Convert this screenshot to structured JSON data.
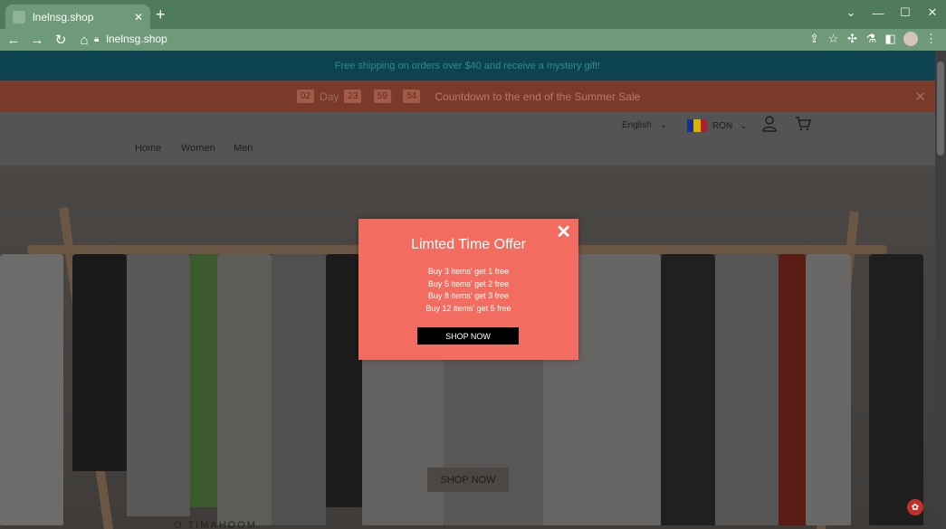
{
  "browser": {
    "tab_title": "lnelnsg.shop",
    "tab_close": "✕",
    "new_tab": "+",
    "url": "lnelnsg.shop",
    "win_controls": [
      "⌄",
      "—",
      "☐",
      "✕"
    ]
  },
  "banner": {
    "shipping_text": "Free shipping on orders over $40 and receive a mystery gift!"
  },
  "countdown": {
    "days": "02",
    "day_label": "Day",
    "hours": "23",
    "minutes": "59",
    "seconds": "54",
    "separator": ":",
    "message": "Countdown to the end of the Summer Sale",
    "close": "✕"
  },
  "header": {
    "nav": [
      "Home",
      "Women",
      "Men"
    ],
    "language": "English",
    "currency": "RON",
    "flag_colors": [
      "#1a2f8c",
      "#d6b400",
      "#b0202a"
    ]
  },
  "hero": {
    "shop_now": "SHOP NOW",
    "footer_text": "O TIMAHOOM"
  },
  "popup": {
    "title": "Limted Time Offer",
    "offers": [
      "Buy 3 items' get 1 free",
      "Buy 5 items' get 2 free",
      "Buy 8 items' get 3 free",
      "Buy 12 items' get 5 free"
    ],
    "cta": "SHOP NOW",
    "close": "✕"
  },
  "icons": [
    "back-icon",
    "forward-icon",
    "reload-icon",
    "home-icon",
    "lock-icon",
    "share-icon",
    "star-icon",
    "extensions-icon",
    "lab-icon",
    "sidepanel-icon",
    "profile-icon",
    "menu-icon",
    "user-icon",
    "cart-icon",
    "chevron-down-icon",
    "help-icon"
  ],
  "colors": {
    "chrome_frame": "#4f7a5c",
    "shipping_bar": "#0d4350",
    "countdown_bar": "#7a3a29",
    "popup_bg": "#f26d60",
    "cta_bg": "#000000"
  }
}
